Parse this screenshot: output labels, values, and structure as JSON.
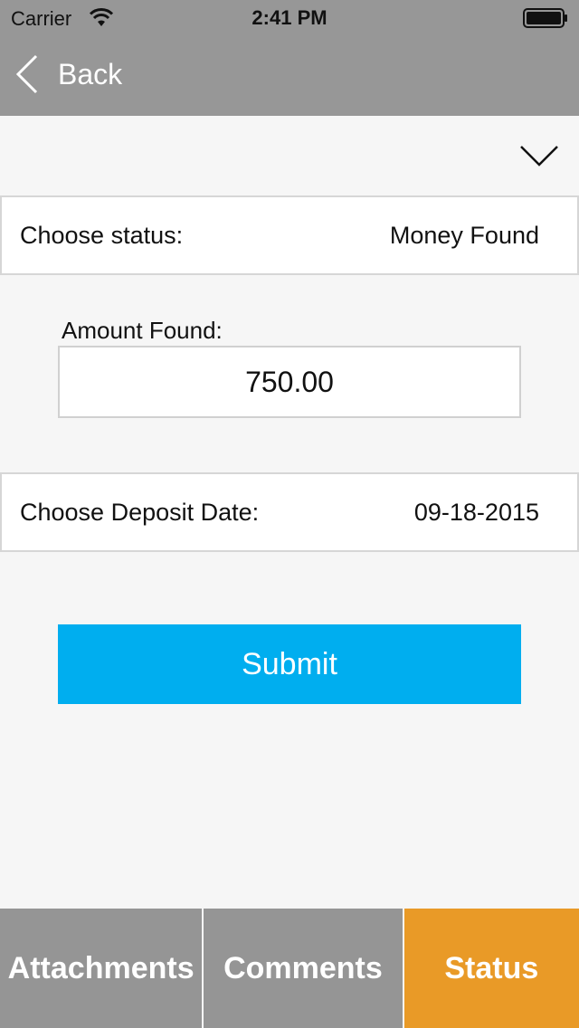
{
  "status_bar": {
    "carrier": "Carrier",
    "time": "2:41 PM",
    "icons": [
      "wifi-icon",
      "battery-icon"
    ]
  },
  "nav": {
    "back_label": "Back",
    "back_icon": "chevron-left-icon",
    "collapse_icon": "chevron-down-icon"
  },
  "form": {
    "status_label": "Choose status:",
    "status_value": "Money Found",
    "amount_label": "Amount Found:",
    "amount_value": "750.00",
    "deposit_label": "Choose Deposit Date:",
    "deposit_value": "09-18-2015",
    "submit_label": "Submit"
  },
  "tabs": [
    {
      "label": "Attachments",
      "active": false
    },
    {
      "label": "Comments",
      "active": false
    },
    {
      "label": "Status",
      "active": true
    }
  ],
  "colors": {
    "header_gray": "#979797",
    "accent_blue": "#00aeef",
    "active_tab_orange": "#e99a27",
    "inactive_tab_gray": "#959595"
  }
}
